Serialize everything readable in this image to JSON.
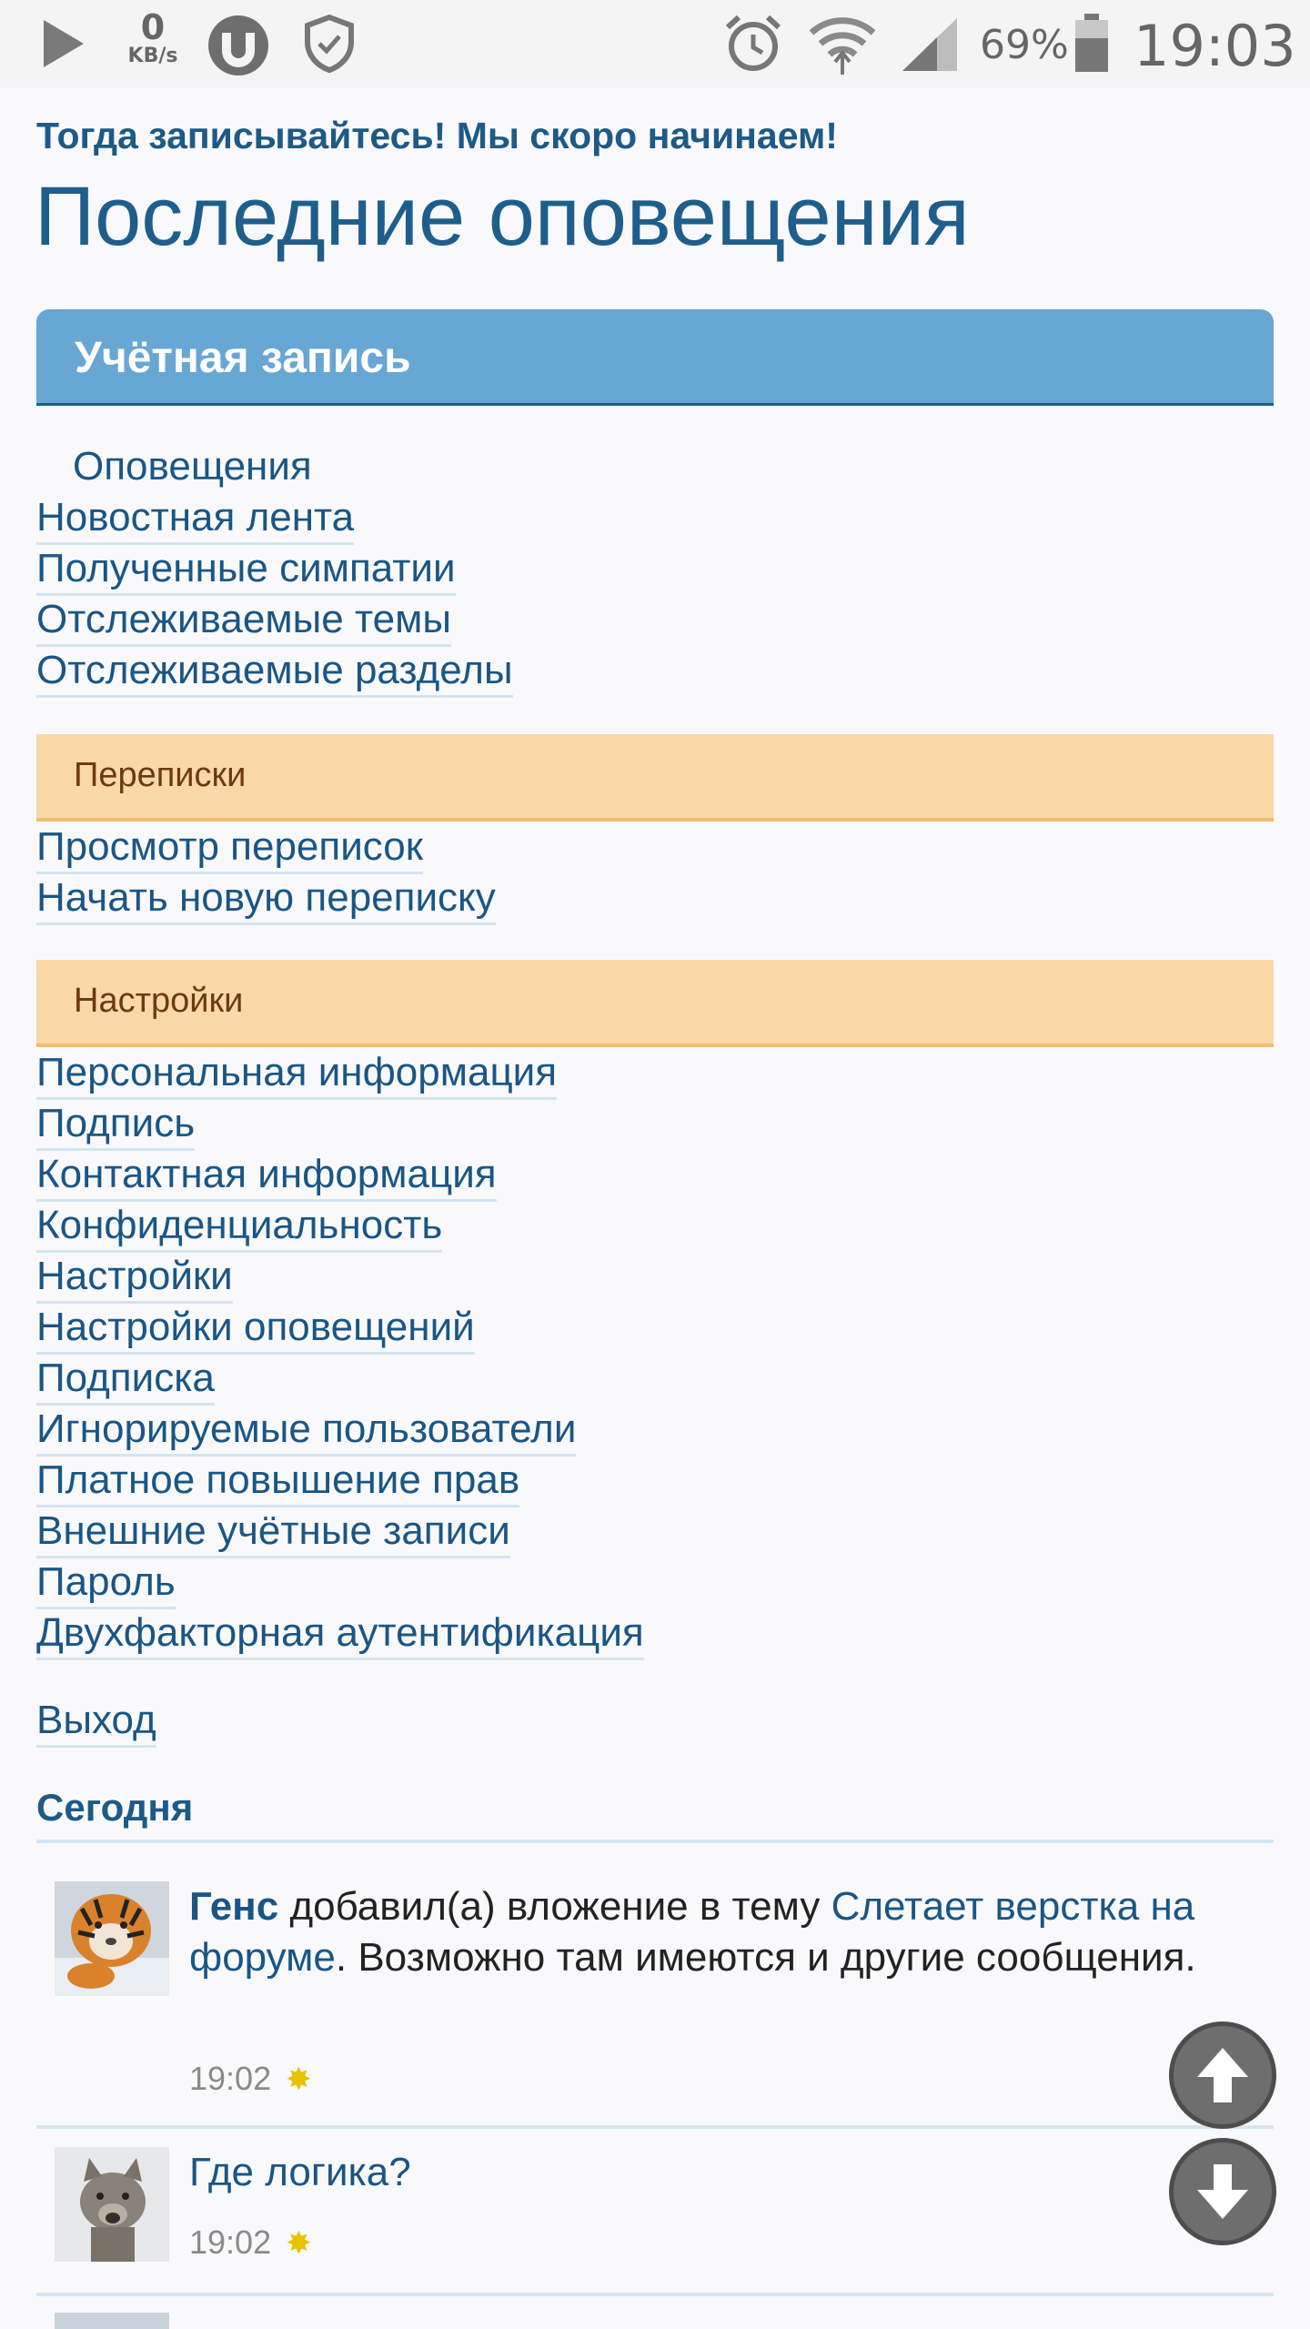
{
  "status_bar": {
    "net_speed_value": "0",
    "net_speed_unit": "KB/s",
    "battery_percent": "69%",
    "time": "19:03",
    "icons": [
      "play-icon",
      "utorrent-icon",
      "shield-icon",
      "alarm-icon",
      "wifi-icon",
      "signal-icon",
      "battery-icon"
    ]
  },
  "promo_text": "Тогда записывайтесь! Мы скоро начинаем!",
  "page_title": "Последние оповещения",
  "account": {
    "header": "Учётная запись",
    "links": [
      "Оповещения",
      "Новостная лента",
      "Полученные симпатии",
      "Отслеживаемые темы",
      "Отслеживаемые разделы"
    ]
  },
  "conversations": {
    "header": "Переписки",
    "links": [
      "Просмотр переписок",
      "Начать новую переписку"
    ]
  },
  "settings": {
    "header": "Настройки",
    "links": [
      "Персональная информация",
      "Подпись",
      "Контактная информация",
      "Конфиденциальность",
      "Настройки",
      "Настройки оповещений",
      "Подписка",
      "Игнорируемые пользователи",
      "Платное повышение прав",
      "Внешние учётные записи",
      "Пароль",
      "Двухфакторная аутентификация"
    ]
  },
  "logout": "Выход",
  "today_header": "Сегодня",
  "notifications": [
    {
      "user": "Генс",
      "action": " добавил(а) вложение в тему ",
      "thread": "Слетает верстка на форуме",
      "suffix": ". Возможно там имеются и другие сообщения.",
      "time": "19:02"
    },
    {
      "text": "Где логика?",
      "time": "19:02"
    }
  ],
  "colors": {
    "link": "#1a5685",
    "blue_header": "#68a6d4",
    "orange_header": "#fbd8a8"
  }
}
